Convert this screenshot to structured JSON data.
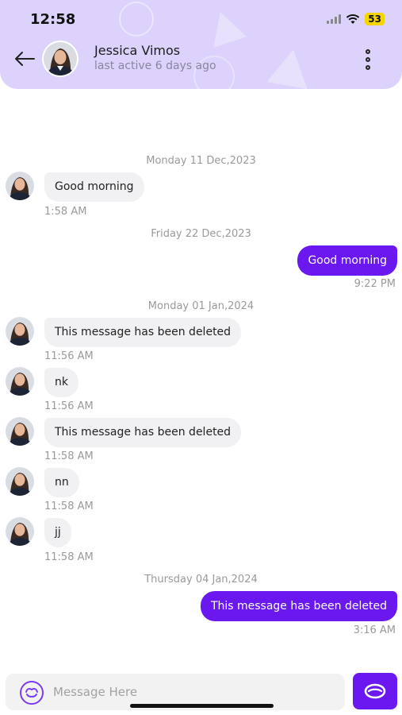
{
  "status_bar": {
    "time": "12:58",
    "battery": "53"
  },
  "header": {
    "contact_name": "Jessica Vimos",
    "last_active": "last active 6 days ago",
    "back_icon": "arrow-left-icon",
    "more_icon": "vertical-dots-icon"
  },
  "messages": {
    "date1": "Monday 11 Dec,2023",
    "m1_text": "Good morning",
    "m1_time": "1:58 AM",
    "date2": "Friday 22 Dec,2023",
    "m2_text": "Good morning",
    "m2_time": "9:22 PM",
    "date3": "Monday 01 Jan,2024",
    "m3_text": "This message has been deleted",
    "m3_time": "11:56 AM",
    "m4_text": "nk",
    "m4_time": "11:56 AM",
    "m5_text": "This message has been deleted",
    "m5_time": "11:58 AM",
    "m6_text": "nn",
    "m6_time": "11:58 AM",
    "m7_text": "jj",
    "m7_time": "11:58 AM",
    "date4": "Thursday 04 Jan,2024",
    "m8_text": "This message has been deleted",
    "m8_time": "3:16 AM"
  },
  "composer": {
    "placeholder": "Message Here",
    "emoji_icon": "smiley-icon",
    "send_icon": "send-icon"
  },
  "colors": {
    "header_bg": "#dcd2fb",
    "accent": "#6a18ef",
    "incoming_bubble": "#f1f1f3"
  }
}
